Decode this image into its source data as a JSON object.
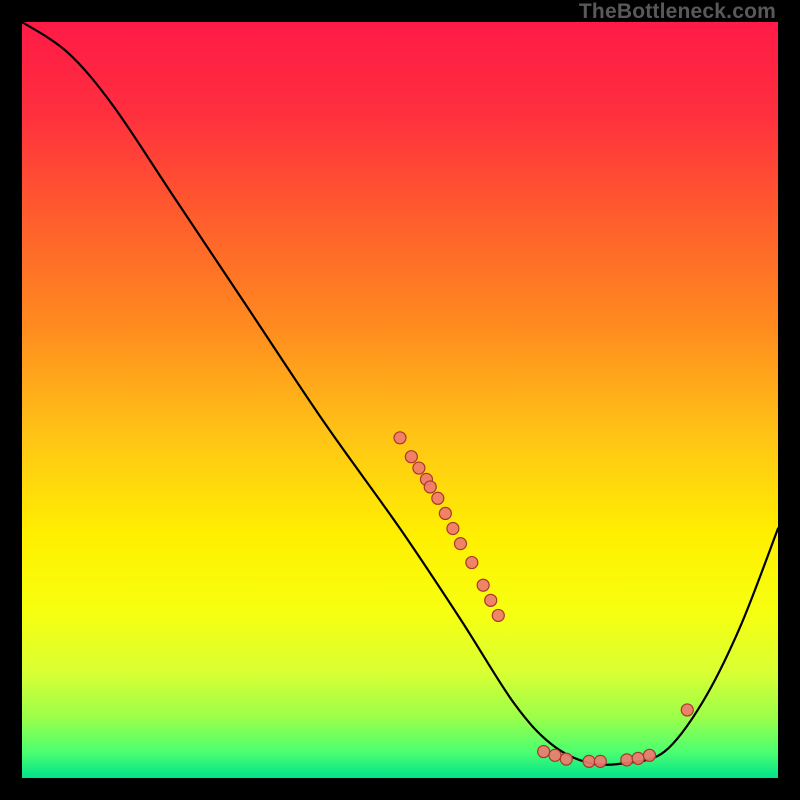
{
  "watermark": "TheBottleneck.com",
  "chart_data": {
    "type": "line",
    "title": "",
    "xlabel": "",
    "ylabel": "",
    "xlim": [
      0,
      100
    ],
    "ylim": [
      0,
      100
    ],
    "grid": false,
    "legend": false,
    "gradient_stops": [
      {
        "offset": 0.0,
        "color": "#ff1a47"
      },
      {
        "offset": 0.12,
        "color": "#ff2f3e"
      },
      {
        "offset": 0.25,
        "color": "#ff5a2e"
      },
      {
        "offset": 0.4,
        "color": "#ff8a1f"
      },
      {
        "offset": 0.55,
        "color": "#ffc515"
      },
      {
        "offset": 0.68,
        "color": "#fff000"
      },
      {
        "offset": 0.78,
        "color": "#f7ff10"
      },
      {
        "offset": 0.86,
        "color": "#d9ff33"
      },
      {
        "offset": 0.92,
        "color": "#9bff4a"
      },
      {
        "offset": 0.965,
        "color": "#4dff70"
      },
      {
        "offset": 1.0,
        "color": "#00e38a"
      }
    ],
    "curve": [
      {
        "x": 0.0,
        "y": 100.0
      },
      {
        "x": 6.0,
        "y": 96.0
      },
      {
        "x": 12.0,
        "y": 89.0
      },
      {
        "x": 20.0,
        "y": 77.0
      },
      {
        "x": 30.0,
        "y": 62.0
      },
      {
        "x": 40.0,
        "y": 47.0
      },
      {
        "x": 50.0,
        "y": 33.0
      },
      {
        "x": 58.0,
        "y": 21.0
      },
      {
        "x": 65.0,
        "y": 10.0
      },
      {
        "x": 70.0,
        "y": 4.5
      },
      {
        "x": 75.0,
        "y": 2.0
      },
      {
        "x": 80.0,
        "y": 2.0
      },
      {
        "x": 85.0,
        "y": 3.5
      },
      {
        "x": 90.0,
        "y": 10.0
      },
      {
        "x": 95.0,
        "y": 20.0
      },
      {
        "x": 100.0,
        "y": 33.0
      }
    ],
    "marker_groups": [
      {
        "name": "cluster-upper",
        "points": [
          {
            "x": 50.0,
            "y": 45.0
          },
          {
            "x": 51.5,
            "y": 42.5
          },
          {
            "x": 52.5,
            "y": 41.0
          },
          {
            "x": 53.5,
            "y": 39.5
          },
          {
            "x": 54.0,
            "y": 38.5
          },
          {
            "x": 55.0,
            "y": 37.0
          },
          {
            "x": 56.0,
            "y": 35.0
          },
          {
            "x": 57.0,
            "y": 33.0
          },
          {
            "x": 58.0,
            "y": 31.0
          },
          {
            "x": 59.5,
            "y": 28.5
          },
          {
            "x": 61.0,
            "y": 25.5
          },
          {
            "x": 62.0,
            "y": 23.5
          },
          {
            "x": 63.0,
            "y": 21.5
          }
        ]
      },
      {
        "name": "cluster-bottom",
        "points": [
          {
            "x": 69.0,
            "y": 3.5
          },
          {
            "x": 70.5,
            "y": 3.0
          },
          {
            "x": 72.0,
            "y": 2.5
          },
          {
            "x": 75.0,
            "y": 2.2
          },
          {
            "x": 76.5,
            "y": 2.2
          },
          {
            "x": 80.0,
            "y": 2.4
          },
          {
            "x": 81.5,
            "y": 2.6
          },
          {
            "x": 83.0,
            "y": 3.0
          }
        ]
      },
      {
        "name": "cluster-right",
        "points": [
          {
            "x": 88.0,
            "y": 9.0
          }
        ]
      }
    ],
    "marker_style": {
      "fill": "#ef7a6f",
      "stroke": "#a8372c",
      "r": 6
    }
  }
}
